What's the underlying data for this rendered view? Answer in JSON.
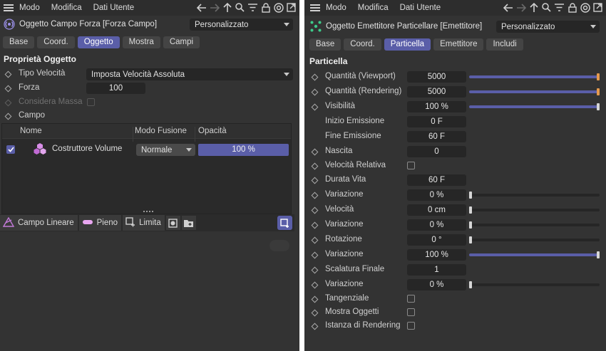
{
  "left": {
    "menu": [
      "Modo",
      "Modifica",
      "Dati Utente"
    ],
    "object_title": "Oggetto Campo Forza [Forza Campo]",
    "preset": "Personalizzato",
    "tabs": [
      {
        "label": "Base",
        "active": false
      },
      {
        "label": "Coord.",
        "active": false
      },
      {
        "label": "Oggetto",
        "active": true
      },
      {
        "label": "Mostra",
        "active": false
      },
      {
        "label": "Campi",
        "active": false
      }
    ],
    "section": "Proprietà Oggetto",
    "props": {
      "tipo_velocita": {
        "label": "Tipo Velocità",
        "value": "Imposta Velocità Assoluta"
      },
      "forza": {
        "label": "Forza",
        "value": "100"
      },
      "considera_massa": {
        "label": "Considera Massa",
        "checked": false
      },
      "campo": {
        "label": "Campo"
      }
    },
    "table": {
      "headers": {
        "name": "Nome",
        "blend": "Modo Fusione",
        "opacity": "Opacità"
      },
      "rows": [
        {
          "enabled": true,
          "name": "Costruttore Volume",
          "blend": "Normale",
          "opacity": "100 %"
        }
      ]
    },
    "toolbar": {
      "linear": "Campo Lineare",
      "solid": "Pieno",
      "clamp": "Limita"
    }
  },
  "right": {
    "menu": [
      "Modo",
      "Modifica",
      "Dati Utente"
    ],
    "object_title": "Oggetto Emettitore Particellare [Emettitore]",
    "preset": "Personalizzato",
    "tabs": [
      {
        "label": "Base",
        "active": false
      },
      {
        "label": "Coord.",
        "active": false
      },
      {
        "label": "Particella",
        "active": true
      },
      {
        "label": "Emettitore",
        "active": false
      },
      {
        "label": "Includi",
        "active": false
      }
    ],
    "section": "Particella",
    "params": [
      {
        "label": "Quantità (Viewport)",
        "value": "5000",
        "diamond": true,
        "slider": 1.0,
        "knob": "orange"
      },
      {
        "label": "Quantità (Rendering)",
        "value": "5000",
        "diamond": true,
        "slider": 1.0,
        "knob": "orange"
      },
      {
        "label": "Visibilità",
        "value": "100 %",
        "diamond": true,
        "slider": 1.0,
        "knob": "white"
      },
      {
        "label": "Inizio Emissione",
        "value": "0 F",
        "diamond": false
      },
      {
        "label": "Fine Emissione",
        "value": "60 F",
        "diamond": false
      },
      {
        "label": "Nascita",
        "value": "0",
        "diamond": true
      },
      {
        "label": "Velocità Relativa",
        "checkbox": true,
        "diamond": true
      },
      {
        "label": "Durata Vita",
        "value": "60 F",
        "diamond": true
      },
      {
        "label": "Variazione",
        "value": "0 %",
        "diamond": true,
        "slider": 0.0,
        "knob": "white"
      },
      {
        "label": "Velocità",
        "value": "0 cm",
        "diamond": true,
        "slider": 0.0,
        "knob": "white"
      },
      {
        "label": "Variazione",
        "value": "0 %",
        "diamond": true,
        "slider": 0.0,
        "knob": "white"
      },
      {
        "label": "Rotazione",
        "value": "0 °",
        "diamond": true,
        "slider": 0.0,
        "knob": "white"
      },
      {
        "label": "Variazione",
        "value": "100 %",
        "diamond": true,
        "slider": 1.0,
        "knob": "white"
      },
      {
        "label": "Scalatura Finale",
        "value": "1",
        "diamond": true
      },
      {
        "label": "Variazione",
        "value": "0 %",
        "diamond": true,
        "slider": 0.0,
        "knob": "white"
      },
      {
        "label": "Tangenziale",
        "checkbox": true,
        "diamond": true
      },
      {
        "label": "Mostra Oggetti",
        "checkbox": true,
        "diamond": true
      },
      {
        "label": "Istanza di Rendering",
        "checkbox": true,
        "diamond": true
      }
    ]
  },
  "colors": {
    "accent": "#5a5ea8",
    "knob_orange": "#e59a4e",
    "panel": "#333333",
    "field": "#262626"
  }
}
